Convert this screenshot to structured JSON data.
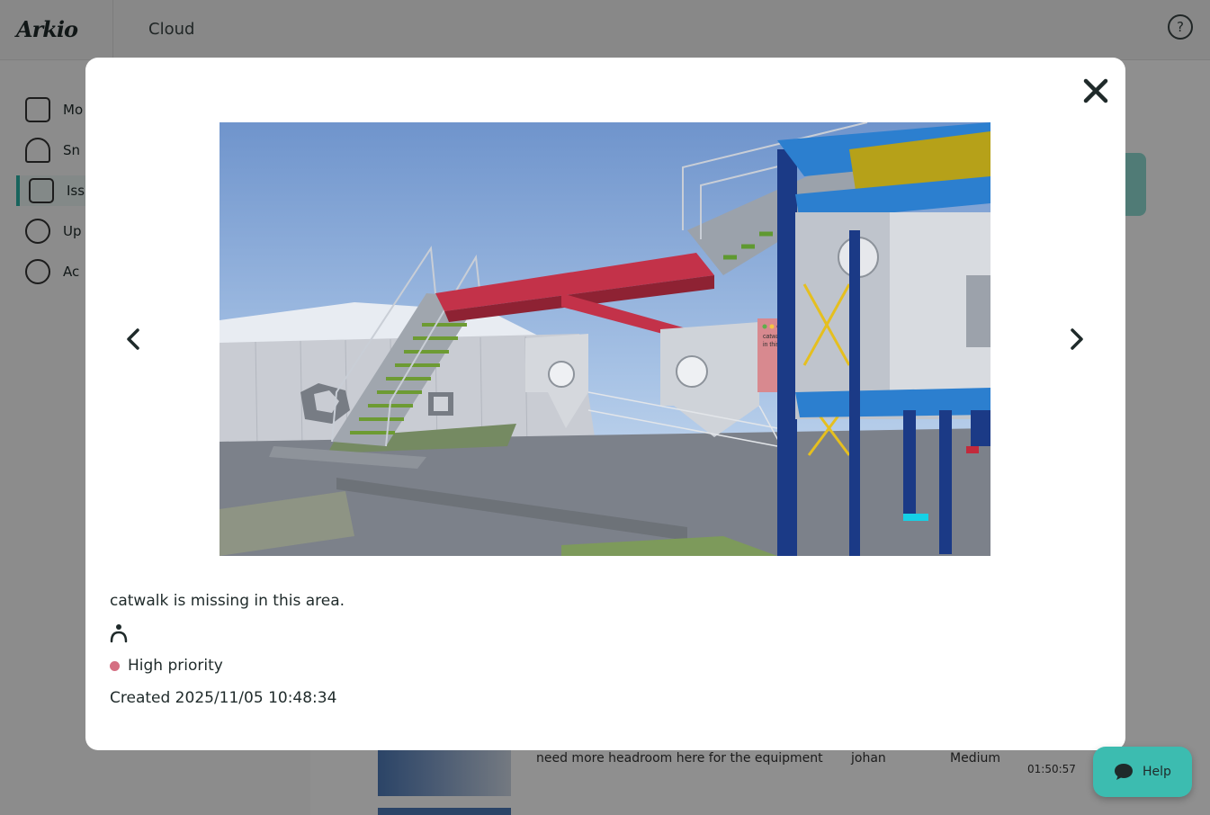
{
  "app": {
    "logo_text": "Arkio",
    "title": "Cloud",
    "help_circle_glyph": "?"
  },
  "sidebar": {
    "items": [
      {
        "icon": "models-icon",
        "label": "Mo"
      },
      {
        "icon": "snapshot-icon",
        "label": "Sn"
      },
      {
        "icon": "issues-icon",
        "label": "Iss"
      },
      {
        "icon": "updates-icon",
        "label": "Up"
      },
      {
        "icon": "account-icon",
        "label": "Ac"
      }
    ]
  },
  "background_row": {
    "text": "need more headroom here for the equipment",
    "user": "johan",
    "priority": "Medium",
    "date": "01:50:57"
  },
  "modal": {
    "caption": "catwalk is missing in this area.",
    "priority_label": "High priority",
    "priority_color": "#d56f82",
    "created_label": "Created 2025/11/05 10:48:34",
    "sticky_note_text": "catwalk is missing in this area."
  },
  "help_button": {
    "label": "Help"
  },
  "colors": {
    "accent": "#3cbcb0",
    "text": "#1f2a2a",
    "overlay": "rgba(0,0,0,0.44)"
  }
}
